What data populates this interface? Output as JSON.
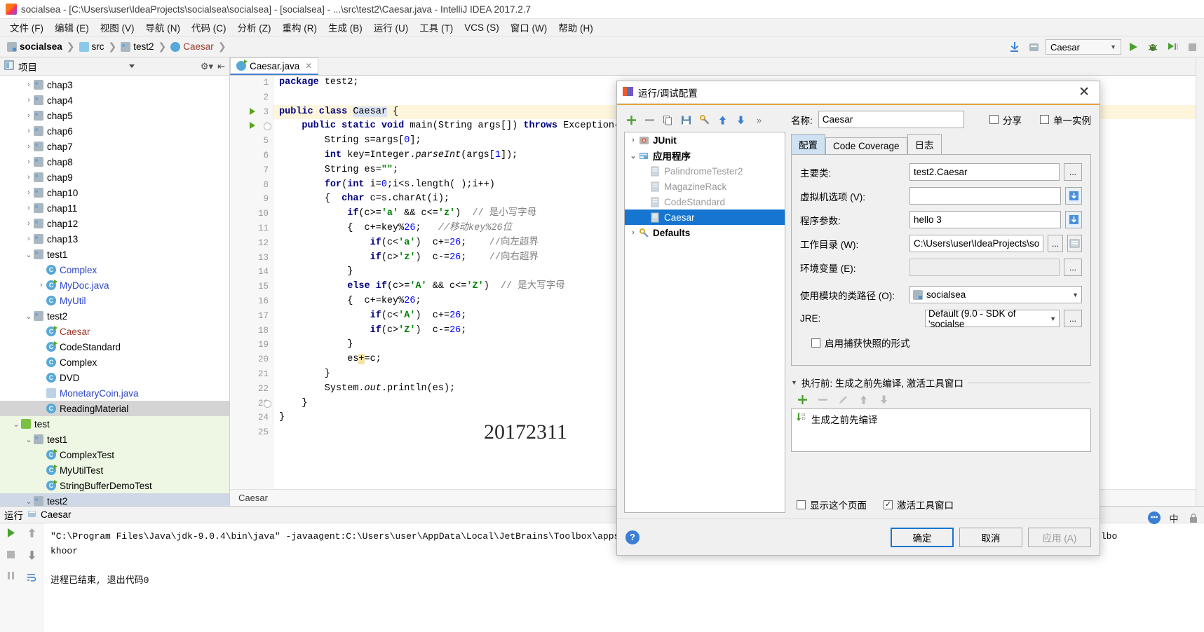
{
  "window": {
    "title": "socialsea - [C:\\Users\\user\\IdeaProjects\\socialsea\\socialsea] - [socialsea] - ...\\src\\test2\\Caesar.java - IntelliJ IDEA 2017.2.7"
  },
  "menu": [
    "文件 (F)",
    "编辑 (E)",
    "视图 (V)",
    "导航 (N)",
    "代码 (C)",
    "分析 (Z)",
    "重构 (R)",
    "生成 (B)",
    "运行 (U)",
    "工具 (T)",
    "VCS (S)",
    "窗口 (W)",
    "帮助 (H)"
  ],
  "navbar": {
    "breadcrumbs": [
      "socialsea",
      "src",
      "test2",
      "Caesar"
    ],
    "run_config": "Caesar"
  },
  "project": {
    "panel_title": "项目",
    "tree": [
      {
        "label": "chap3",
        "indent": 0,
        "arrow": "›",
        "icon": "folder",
        "state": "normal"
      },
      {
        "label": "chap4",
        "indent": 0,
        "arrow": "›",
        "icon": "folder",
        "state": "normal"
      },
      {
        "label": "chap5",
        "indent": 0,
        "arrow": "›",
        "icon": "folder",
        "state": "normal"
      },
      {
        "label": "chap6",
        "indent": 0,
        "arrow": "›",
        "icon": "folder",
        "state": "normal"
      },
      {
        "label": "chap7",
        "indent": 0,
        "arrow": "›",
        "icon": "folder",
        "state": "normal"
      },
      {
        "label": "chap8",
        "indent": 0,
        "arrow": "›",
        "icon": "folder",
        "state": "normal"
      },
      {
        "label": "chap9",
        "indent": 0,
        "arrow": "›",
        "icon": "folder",
        "state": "normal"
      },
      {
        "label": "chap10",
        "indent": 0,
        "arrow": "›",
        "icon": "folder",
        "state": "normal"
      },
      {
        "label": "chap11",
        "indent": 0,
        "arrow": "›",
        "icon": "folder",
        "state": "normal"
      },
      {
        "label": "chap12",
        "indent": 0,
        "arrow": "›",
        "icon": "folder",
        "state": "normal"
      },
      {
        "label": "chap13",
        "indent": 0,
        "arrow": "›",
        "icon": "folder",
        "state": "normal"
      },
      {
        "label": "test1",
        "indent": 0,
        "arrow": "⌄",
        "icon": "folder",
        "state": "normal"
      },
      {
        "label": "Complex",
        "indent": 1,
        "arrow": "",
        "icon": "class",
        "state": "blue"
      },
      {
        "label": "MyDoc.java",
        "indent": 0,
        "arrow": "›",
        "icon": "class-run",
        "state": "blue",
        "pad": 52
      },
      {
        "label": "MyUtil",
        "indent": 1,
        "arrow": "",
        "icon": "class",
        "state": "blue"
      },
      {
        "label": "test2",
        "indent": 0,
        "arrow": "⌄",
        "icon": "folder",
        "state": "normal"
      },
      {
        "label": "Caesar",
        "indent": 1,
        "arrow": "",
        "icon": "class-run",
        "state": "red"
      },
      {
        "label": "CodeStandard",
        "indent": 1,
        "arrow": "",
        "icon": "class-run",
        "state": "normal"
      },
      {
        "label": "Complex",
        "indent": 1,
        "arrow": "",
        "icon": "class",
        "state": "normal"
      },
      {
        "label": "DVD",
        "indent": 1,
        "arrow": "",
        "icon": "class",
        "state": "normal"
      },
      {
        "label": "MonetaryCoin.java",
        "indent": 1,
        "arrow": "",
        "icon": "file-java",
        "state": "blue"
      },
      {
        "label": "ReadingMaterial",
        "indent": 1,
        "arrow": "",
        "icon": "class",
        "state": "normal",
        "row": "sel-gray"
      },
      {
        "label": "test",
        "indent": 0,
        "arrow": "⌄",
        "icon": "folder-green",
        "state": "normal",
        "row": "green",
        "pad": 16
      },
      {
        "label": "test1",
        "indent": 0,
        "arrow": "⌄",
        "icon": "folder",
        "state": "normal",
        "row": "green",
        "pad": 34
      },
      {
        "label": "ComplexTest",
        "indent": 1,
        "arrow": "",
        "icon": "class-run",
        "state": "green-txt",
        "row": "green"
      },
      {
        "label": "MyUtilTest",
        "indent": 1,
        "arrow": "",
        "icon": "class-run",
        "state": "green-txt",
        "row": "green"
      },
      {
        "label": "StringBufferDemoTest",
        "indent": 1,
        "arrow": "",
        "icon": "class-run",
        "state": "green-txt",
        "row": "green"
      },
      {
        "label": "test2",
        "indent": 0,
        "arrow": "⌄",
        "icon": "folder",
        "state": "normal",
        "row": "green sel-blue",
        "pad": 34
      }
    ]
  },
  "editor": {
    "tab": "Caesar.java",
    "breadcrumb_bottom": "Caesar",
    "watermark": "20172311",
    "lines": [
      {
        "n": "1",
        "html": "<span class='kw'>package</span> test2;"
      },
      {
        "n": "2",
        "html": ""
      },
      {
        "n": "3",
        "html": "<span class='kw'>public class</span> <span class='hl-ident'>Caesar</span> {",
        "mark": "run",
        "hl": true
      },
      {
        "n": "4",
        "html": "    <span class='kw'>public static void</span> main(String args[]) <span class='kw'>throws</span> Exception{",
        "mark": "run",
        "fold": true
      },
      {
        "n": "5",
        "html": "        String s=args[<span class='num'>0</span>];"
      },
      {
        "n": "6",
        "html": "        <span class='kw'>int</span> key=Integer.<span class='ital'>parseInt</span>(args[<span class='num'>1</span>]);"
      },
      {
        "n": "7",
        "html": "        String es=<span class='str'>\"\"</span>;"
      },
      {
        "n": "8",
        "html": "        <span class='kw'>for</span>(<span class='kw'>int</span> i=<span class='num'>0</span>;i&lt;s.length( );i++)"
      },
      {
        "n": "9",
        "html": "        {  <span class='kw'>char</span> c=s.charAt(i);"
      },
      {
        "n": "10",
        "html": "            <span class='kw'>if</span>(c&gt;=<span class='str'>'a'</span> &amp;&amp; c&lt;=<span class='str'>'z'</span>)  <span class='cmt-plain'>// 是小写字母</span>"
      },
      {
        "n": "11",
        "html": "            {  c+=key%<span class='num'>26</span>;   <span class='cmt'>//移动key%26位</span>"
      },
      {
        "n": "12",
        "html": "                <span class='kw'>if</span>(c&lt;<span class='str'>'a'</span>)  c+=<span class='num'>26</span>;    <span class='cmt-plain'>//向左超界</span>"
      },
      {
        "n": "13",
        "html": "                <span class='kw'>if</span>(c&gt;<span class='str'>'z'</span>)  c-=<span class='num'>26</span>;    <span class='cmt-plain'>//向右超界</span>"
      },
      {
        "n": "14",
        "html": "            }"
      },
      {
        "n": "15",
        "html": "            <span class='kw'>else if</span>(c&gt;=<span class='str'>'A'</span> &amp;&amp; c&lt;=<span class='str'>'Z'</span>)  <span class='cmt-plain'>// 是大写字母</span>"
      },
      {
        "n": "16",
        "html": "            {  c+=key%<span class='num'>26</span>;"
      },
      {
        "n": "17",
        "html": "                <span class='kw'>if</span>(c&lt;<span class='str'>'A'</span>)  c+=<span class='num'>26</span>;"
      },
      {
        "n": "18",
        "html": "                <span class='kw'>if</span>(c&gt;<span class='str'>'Z'</span>)  c-=<span class='num'>26</span>;"
      },
      {
        "n": "19",
        "html": "            }"
      },
      {
        "n": "20",
        "html": "            es<span class='caretmark'>+</span>=c;"
      },
      {
        "n": "21",
        "html": "        }"
      },
      {
        "n": "22",
        "html": "        System.<span class='ital'>out</span>.println(es);"
      },
      {
        "n": "23",
        "html": "    }",
        "fold": true
      },
      {
        "n": "24",
        "html": "}"
      },
      {
        "n": "25",
        "html": ""
      }
    ]
  },
  "run_panel": {
    "label": "运行",
    "tab": "Caesar",
    "console_lines": [
      "\"C:\\Program Files\\Java\\jdk-9.0.4\\bin\\java\" -javaagent:C:\\Users\\user\\AppData\\Local\\JetBrains\\Toolbox\\apps\\IDEA-U\\ch-2\\172.4574.19\\lib\\idea_rt.jar=60085:C:\\Users\\user\\AppData\\Local\\JetBrains\\Toolbo",
      "khoor",
      "",
      "进程已结束, 退出代码0"
    ]
  },
  "dialog": {
    "title": "运行/调试配置",
    "toolbar_icons": [
      "add-icon",
      "remove-icon",
      "copy-icon",
      "save-icon",
      "edit-templates-icon",
      "move-up-icon",
      "move-down-icon",
      "more-icon"
    ],
    "config_tree": [
      {
        "label": "JUnit",
        "arrow": "›",
        "bold": true,
        "dim": false,
        "selected": false,
        "icon": "junit-icon"
      },
      {
        "label": "应用程序",
        "arrow": "⌄",
        "bold": true,
        "dim": false,
        "selected": false,
        "icon": "application-icon"
      },
      {
        "label": "PalindromeTester2",
        "arrow": "",
        "bold": false,
        "dim": true,
        "selected": false,
        "icon": "config-icon"
      },
      {
        "label": "MagazineRack",
        "arrow": "",
        "bold": false,
        "dim": true,
        "selected": false,
        "icon": "config-icon"
      },
      {
        "label": "CodeStandard",
        "arrow": "",
        "bold": false,
        "dim": true,
        "selected": false,
        "icon": "config-icon"
      },
      {
        "label": "Caesar",
        "arrow": "",
        "bold": false,
        "dim": false,
        "selected": true,
        "icon": "config-icon"
      },
      {
        "label": "Defaults",
        "arrow": "›",
        "bold": true,
        "dim": false,
        "selected": false,
        "icon": "defaults-icon"
      }
    ],
    "name_label": "名称:",
    "name_value": "Caesar",
    "share_label": "分享",
    "share_checked": false,
    "single_instance_label": "单一实例",
    "single_instance_checked": false,
    "tabs": [
      {
        "label": "配置",
        "active": true
      },
      {
        "label": "Code Coverage",
        "active": false
      },
      {
        "label": "日志",
        "active": false
      }
    ],
    "fields": [
      {
        "label": "主要类:",
        "value": "test2.Caesar",
        "readonly": false,
        "button": "...",
        "kind": "text-btn"
      },
      {
        "label": "虚拟机选项 (V):",
        "value": "",
        "readonly": false,
        "button": "expand-icon",
        "kind": "text-expand"
      },
      {
        "label": "程序参数:",
        "value": "hello 3",
        "readonly": false,
        "button": "expand-icon",
        "kind": "text-expand"
      },
      {
        "label": "工作目录 (W):",
        "value": "C:\\Users\\user\\IdeaProjects\\so",
        "readonly": false,
        "button": "browse-icon",
        "kind": "text-two-btn"
      },
      {
        "label": "环境变量 (E):",
        "value": "",
        "readonly": true,
        "button": "...",
        "kind": "text-btn"
      }
    ],
    "module_label": "使用模块的类路径 (O):",
    "module_value": "socialsea",
    "jre_label": "JRE:",
    "jre_value": "Default (9.0 - SDK of 'socialse",
    "snapshot_label": "启用捕获快照的形式",
    "snapshot_checked": false,
    "before_launch_title": "执行前: 生成之前先编译, 激活工具窗口",
    "before_launch_items": [
      "生成之前先编译"
    ],
    "before_toolbar_icons": [
      "add-icon",
      "remove-icon",
      "edit-icon",
      "move-up-icon",
      "move-down-icon"
    ],
    "show_page_label": "显示这个页面",
    "show_page_checked": false,
    "activate_toolwindow_label": "激活工具窗口",
    "activate_toolwindow_checked": true,
    "buttons": {
      "ok": "确定",
      "cancel": "取消",
      "apply": "应用 (A)"
    }
  },
  "colors": {
    "accent_blue": "#1675d0",
    "selection_blue": "#1675d0",
    "dialog_border_orange": "#e8a33d",
    "run_green": "#58a618"
  }
}
